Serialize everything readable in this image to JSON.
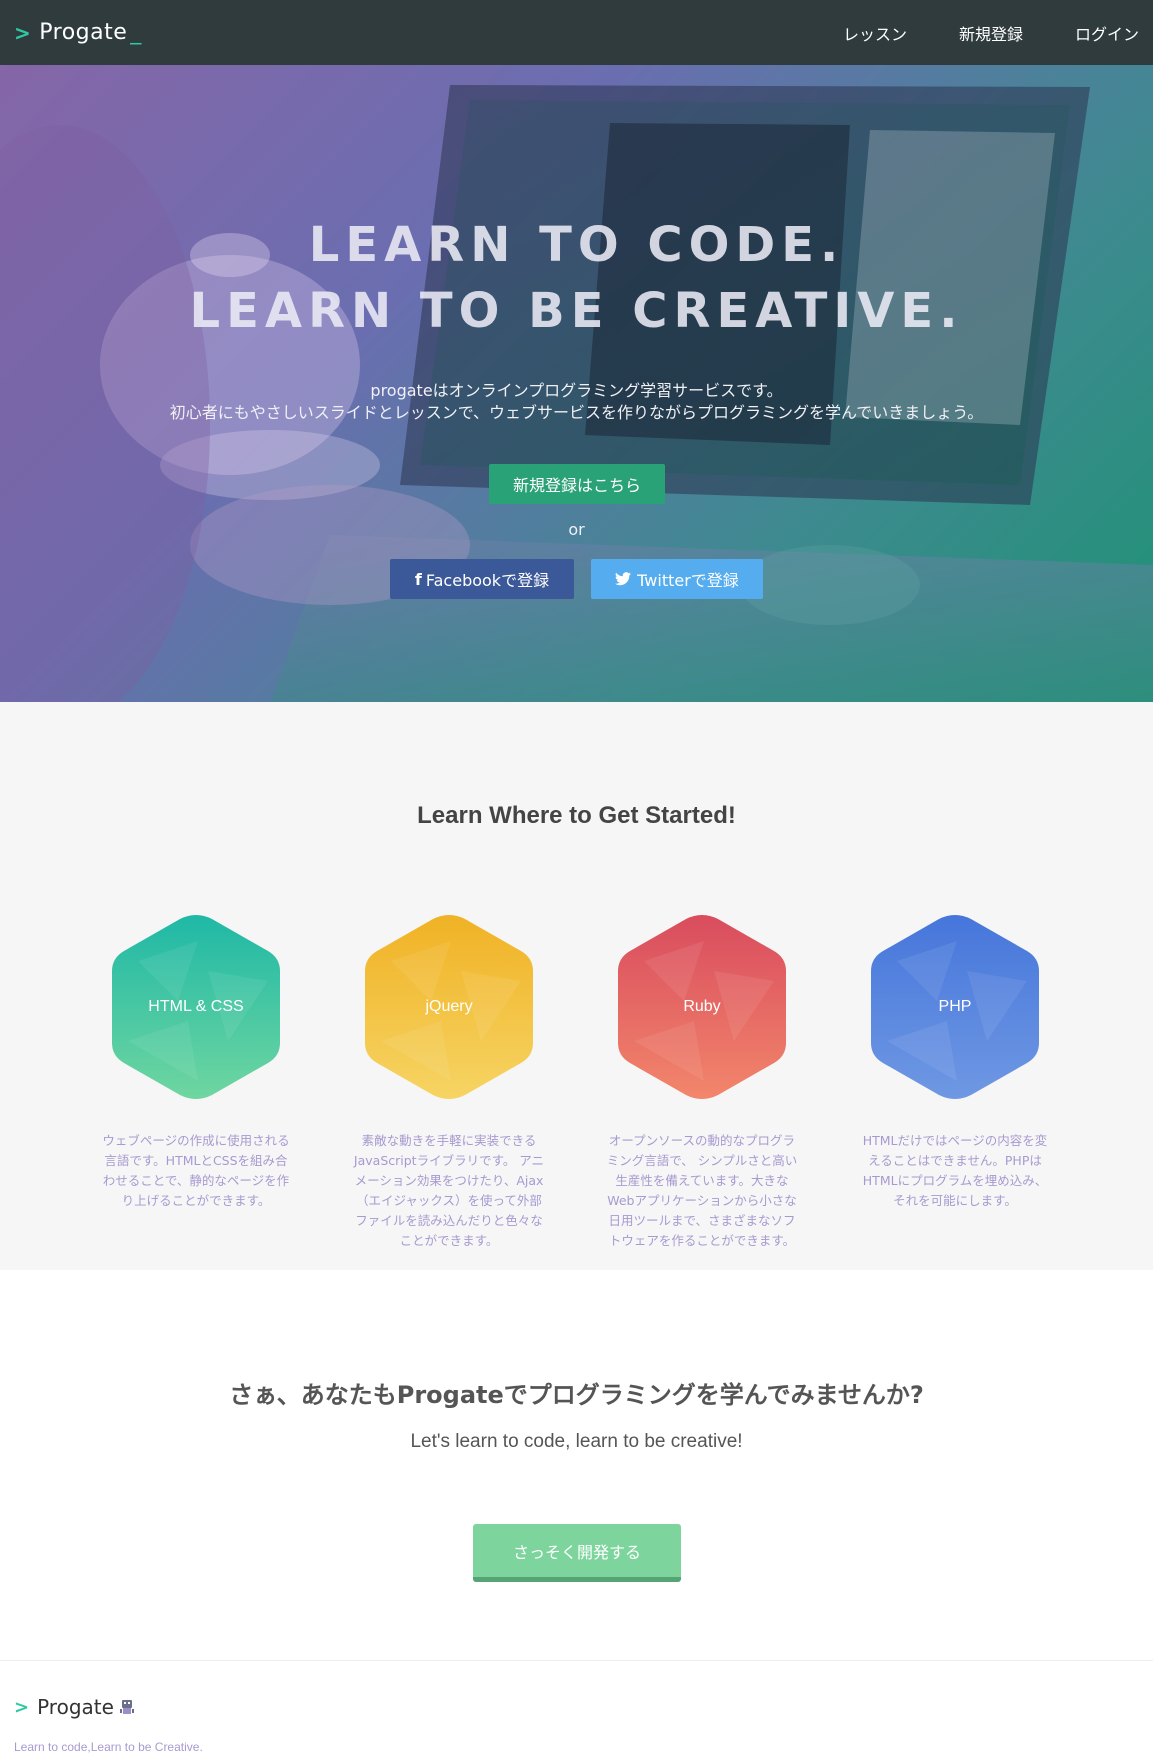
{
  "header": {
    "logo_text": "Progate",
    "nav": [
      "レッスン",
      "新規登録",
      "ログイン"
    ]
  },
  "hero": {
    "title_line1": "LEARN TO CODE.",
    "title_line2": "LEARN TO BE CREATIVE.",
    "desc_line1": "progateはオンラインプログラミング学習サービスです。",
    "desc_line2": "初心者にもやさしいスライドとレッスンで、ウェブサービスを作りながらプログラミングを学んでいきましょう。",
    "signup_label": "新規登録はこちら",
    "or_label": "or",
    "facebook_label": "Facebookで登録",
    "twitter_label": "Twitterで登録"
  },
  "courses": {
    "title": "Learn Where to Get Started!",
    "items": [
      {
        "name": "HTML & CSS",
        "desc_lines": [
          "ウェブページの作成に使用される",
          "言語です。HTMLとCSSを組み合",
          "わせることで、静的なページを作",
          "り上げることができます。"
        ],
        "color_top": "#1fb8a6",
        "color_bottom": "#6fd6a0"
      },
      {
        "name": "jQuery",
        "desc_lines": [
          "素敵な動きを手軽に実装できる",
          "JavaScriptライブラリです。 アニ",
          "メーション効果をつけたり、Ajax",
          "（エイジャックス）を使って外部",
          "ファイルを読み込んだりと色々な",
          "ことができます。"
        ],
        "color_top": "#f0b225",
        "color_bottom": "#f6d463"
      },
      {
        "name": "Ruby",
        "desc_lines": [
          "オープンソースの動的なプログラ",
          "ミング言語で、 シンプルさと高い",
          "生産性を備えています。大きな",
          "Webアプリケーションから小さな",
          "日用ツールまで、さまざまなソフ",
          "トウェアを作ることができます。"
        ],
        "color_top": "#d94c5e",
        "color_bottom": "#f2866b"
      },
      {
        "name": "PHP",
        "desc_lines": [
          "HTMLだけではページの内容を変",
          "えることはできません。PHPは",
          "HTMLにプログラムを埋め込み、",
          "それを可能にします。"
        ],
        "color_top": "#4676db",
        "color_bottom": "#6f98e3"
      }
    ]
  },
  "cta": {
    "title": "さぁ、あなたもProgateでプログラミングを学んでみませんか?",
    "subtitle": "Let's learn to code, learn to be creative!",
    "button_label": "さっそく開発する"
  },
  "footer": {
    "logo_text": "Progate",
    "tagline": "Learn to code,Learn to be Creative."
  },
  "colors": {
    "header_bg": "#2f3b3d",
    "accent": "#2ec9a4",
    "signup_green": "#2aa277",
    "facebook": "#3b5998",
    "twitter": "#55acee",
    "cta_green": "#7dd49d",
    "desc_purple": "#a79ad0"
  }
}
